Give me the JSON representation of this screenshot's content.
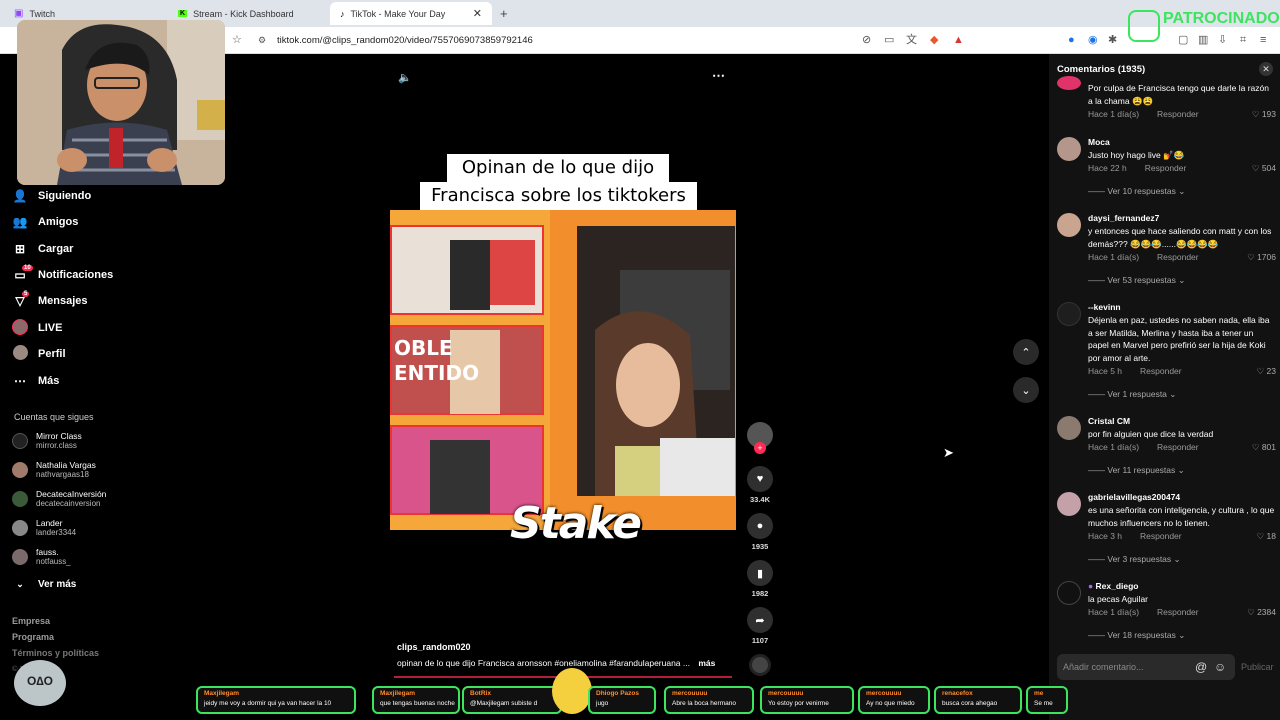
{
  "browser": {
    "tabs": [
      {
        "label": "Twitch",
        "active": false
      },
      {
        "label": "Stream - Kick Dashboard",
        "active": false
      },
      {
        "label": "TikTok - Make Your Day",
        "active": true
      }
    ],
    "url": "tiktok.com/@clips_random020/video/7557069073859792146"
  },
  "sidebar": {
    "nav": [
      {
        "label": "Siguiendo",
        "icon": "following-icon"
      },
      {
        "label": "Amigos",
        "icon": "friends-icon"
      },
      {
        "label": "Cargar",
        "icon": "upload-icon"
      },
      {
        "label": "Notificaciones",
        "icon": "bell-icon",
        "badge": "10"
      },
      {
        "label": "Mensajes",
        "icon": "message-icon",
        "badge": "5"
      },
      {
        "label": "LIVE",
        "icon": "live-icon"
      },
      {
        "label": "Perfil",
        "icon": "profile-icon"
      },
      {
        "label": "Más",
        "icon": "more-icon"
      }
    ],
    "following_title": "Cuentas que sigues",
    "following": [
      {
        "name": "Mirror Class",
        "user": "mirror.class"
      },
      {
        "name": "Nathalia Vargas",
        "user": "nathvargaas18"
      },
      {
        "name": "DecatecaInversión",
        "user": "decatecainversion"
      },
      {
        "name": "Lander",
        "user": "lander3344"
      },
      {
        "name": "fauss.",
        "user": "notfauss_"
      }
    ],
    "see_more": "Ver más",
    "footer": [
      "Empresa",
      "Programa",
      "Términos y políticas",
      "© 2025 TikTok"
    ]
  },
  "video": {
    "caption_line1": "Opinan de lo que dijo",
    "caption_line2": "Francisca sobre los tiktokers",
    "watermark": "Stake",
    "author": "clips_random020",
    "description": "opinan de lo que dijo Francisca aronsson  #oneliamolina  #farandulaperuana ...",
    "more_label": "más",
    "likes": "33.4K",
    "comments": "1935",
    "saves": "1982",
    "shares": "1107"
  },
  "comments_panel": {
    "title": "Comentarios (1935)",
    "reply_label": "Responder",
    "items": [
      {
        "user": "",
        "text": "Por culpa de Francisca tengo que darle la razón a la chama 😩😩",
        "time": "Hace 1 día(s)",
        "likes": "193",
        "replies": ""
      },
      {
        "user": "Moca",
        "text": "Justo hoy hago live 💅😂",
        "time": "Hace 22 h",
        "likes": "504",
        "replies": "Ver 10 respuestas"
      },
      {
        "user": "daysi_fernandez7",
        "text": "y entonces que hace saliendo con matt y con los demás??? 😂😂😂......😂😂😂😂",
        "time": "Hace 1 día(s)",
        "likes": "1706",
        "replies": "Ver 53 respuestas"
      },
      {
        "user": "--kevinn",
        "text": "Déjenla en paz, ustedes no saben nada, ella iba a ser Matilda, Merlina y hasta iba a tener un papel en Marvel pero prefirió ser la hija de Koki por amor al arte.",
        "time": "Hace 5 h",
        "likes": "23",
        "replies": "Ver 1 respuesta"
      },
      {
        "user": "Cristal CM",
        "text": "por fin alguien que dice la verdad",
        "time": "Hace 1 día(s)",
        "likes": "801",
        "replies": "Ver 11 respuestas"
      },
      {
        "user": "gabrielavillegas200474",
        "text": "es una señorita con inteligencia, y cultura , lo que muchos influencers no lo tienen.",
        "time": "Hace 3 h",
        "likes": "18",
        "replies": "Ver 3 respuestas"
      },
      {
        "user": "Rex_diego",
        "text": "la pecas Aguilar",
        "time": "Hace 1 día(s)",
        "likes": "2384",
        "replies": "Ver 18 respuestas"
      }
    ],
    "input_placeholder": "Añadir comentario...",
    "publish": "Publicar"
  },
  "overlay": {
    "sponsor": "PATROCINADOR",
    "chat": [
      {
        "name": "Maxjilegam",
        "msg": "jeidy me voy a dormir qui ya van hacer la 10"
      },
      {
        "name": "Maxjilegam",
        "msg": "que tengas buenas noche"
      },
      {
        "name": "BotRix",
        "msg": "@Maxjilegam subiste d"
      },
      {
        "name": "Dhiogo Pazos",
        "msg": "jugo"
      },
      {
        "name": "mercouuuu",
        "msg": "Abre la boca hermano"
      },
      {
        "name": "mercouuuu",
        "msg": "Yo estoy por venirme"
      },
      {
        "name": "mercouuuu",
        "msg": "Ay no que miedo"
      },
      {
        "name": "renacefox",
        "msg": "busca cora ahegao"
      },
      {
        "name": "me",
        "msg": "Se me"
      }
    ]
  },
  "colors": {
    "accent": "#fe2c55",
    "chat_border": "#3ce55e",
    "chat_name": "#ff8c2a"
  }
}
